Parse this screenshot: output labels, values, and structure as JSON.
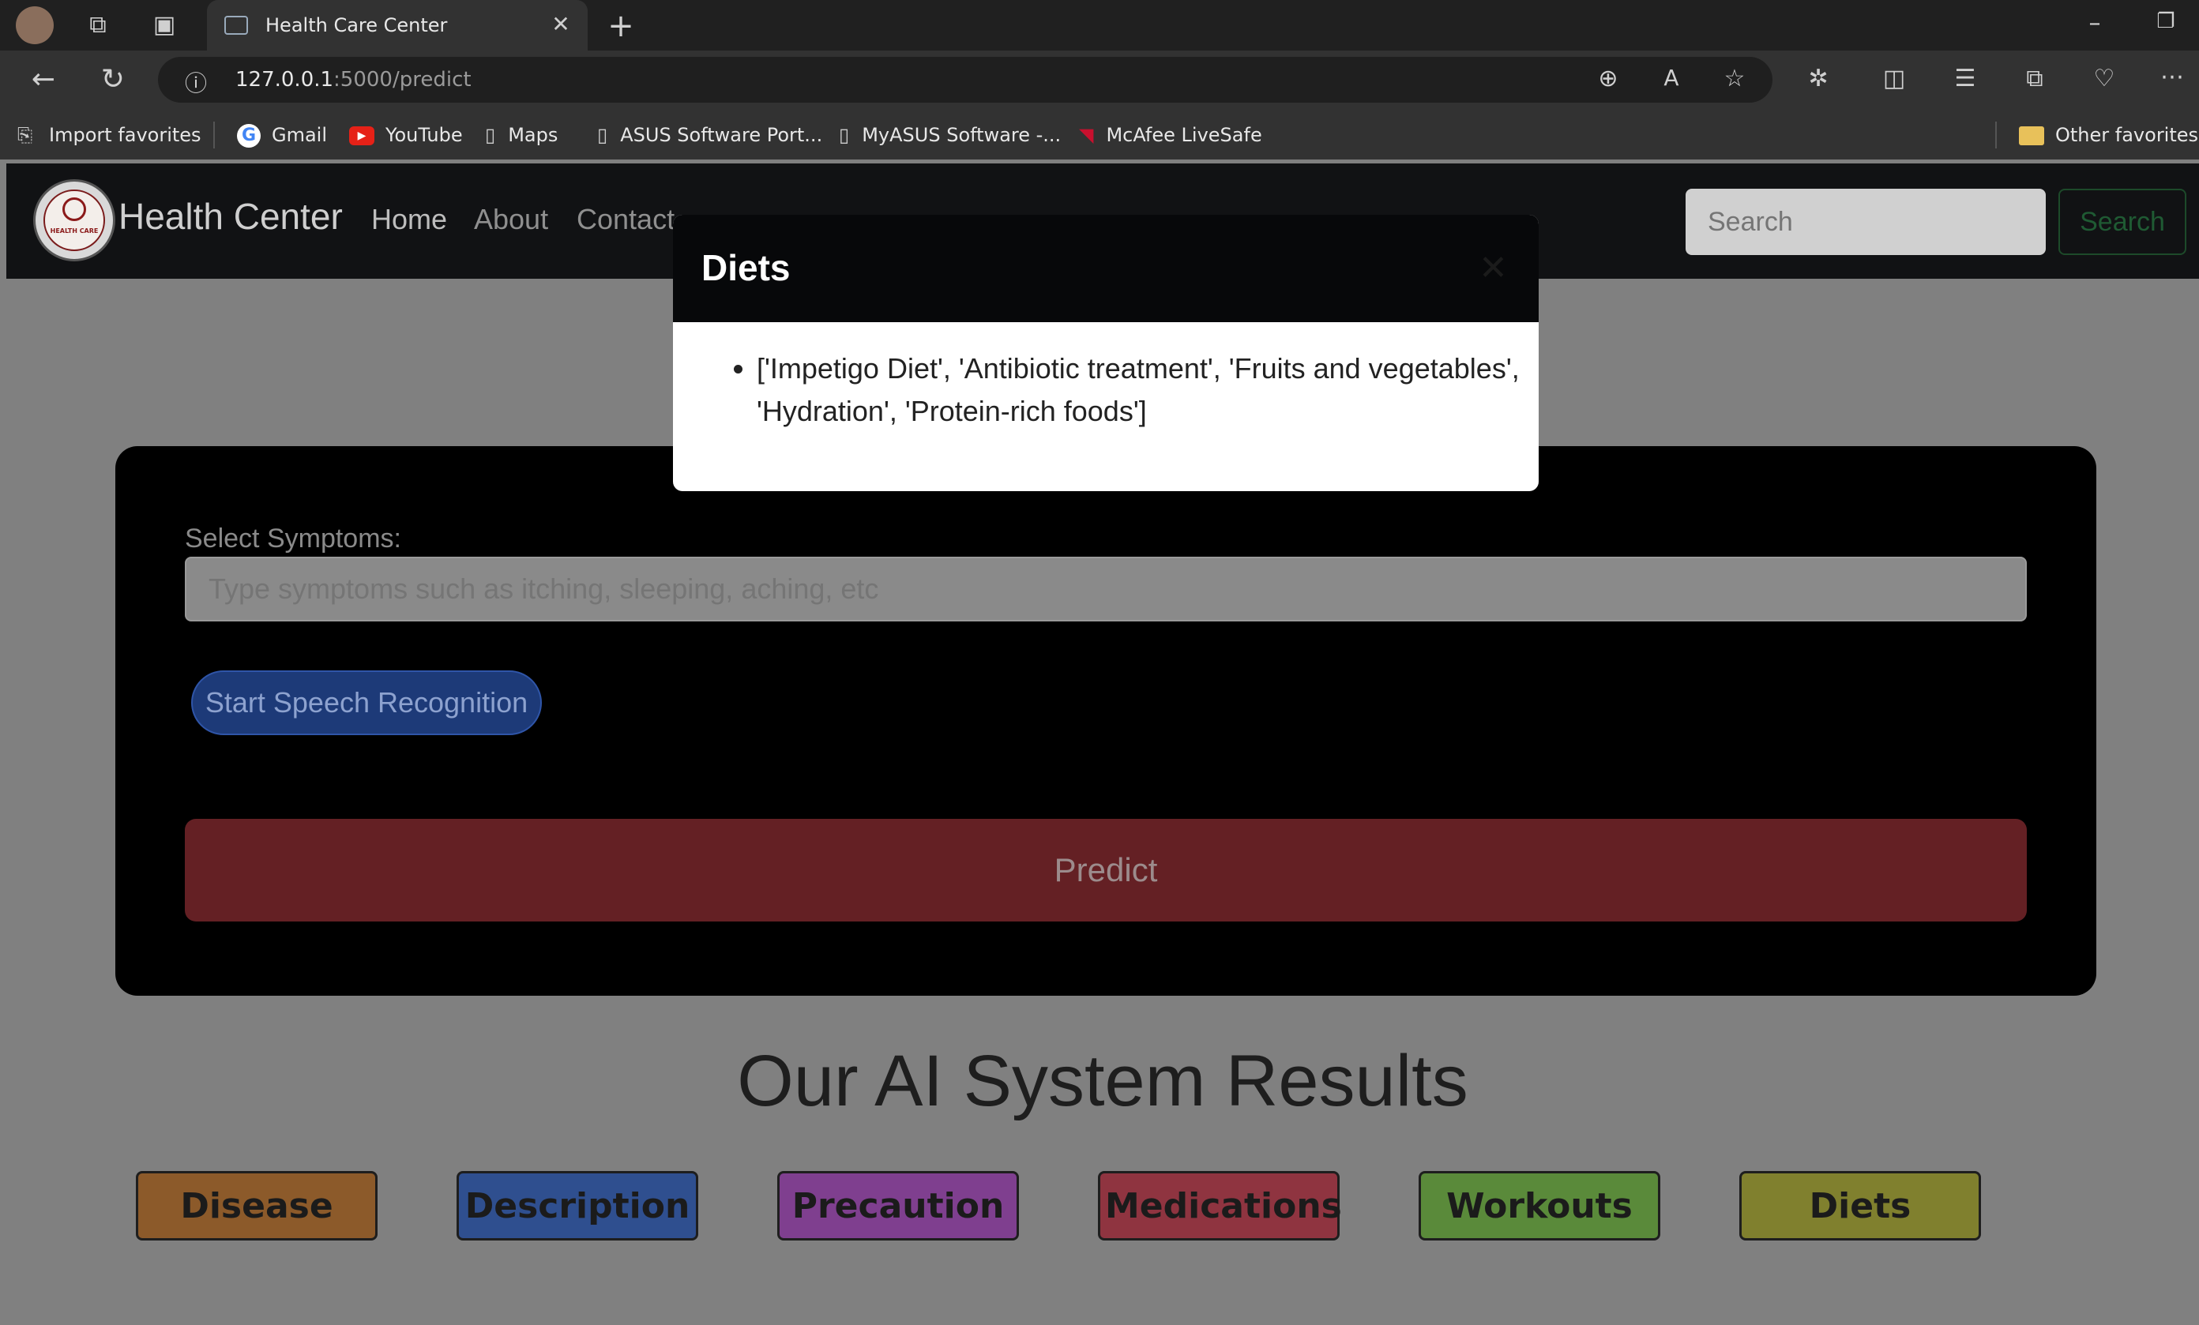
{
  "browser": {
    "tab_title": "Health Care Center",
    "url_host": "127.0.0.1",
    "url_path": ":5000/predict",
    "bookmarks": [
      "Import favorites",
      "Gmail",
      "YouTube",
      "Maps",
      "ASUS Software Port...",
      "MyASUS Software -...",
      "McAfee LiveSafe"
    ],
    "other_favorites": "Other favorites"
  },
  "navbar": {
    "brand": "Health Center",
    "logo_text": "HEALTH CARE",
    "links": [
      "Home",
      "About",
      "Contact"
    ],
    "search_placeholder": "Search",
    "search_button": "Search"
  },
  "form": {
    "symptoms_label": "Select Symptoms:",
    "symptoms_placeholder": "Type symptoms such as itching, sleeping, aching, etc",
    "speech_button": "Start Speech Recognition",
    "predict_button": "Predict"
  },
  "results": {
    "title": "Our AI System Results",
    "buttons": [
      {
        "label": "Disease",
        "color": "#8c5a2a"
      },
      {
        "label": "Description",
        "color": "#2f4f8f"
      },
      {
        "label": "Precaution",
        "color": "#7f3f8f"
      },
      {
        "label": "Medications",
        "color": "#8f3440"
      },
      {
        "label": "Workouts",
        "color": "#5a8a3a"
      },
      {
        "label": "Diets",
        "color": "#80802e"
      }
    ]
  },
  "modal": {
    "title": "Diets",
    "items": [
      "['Impetigo Diet', 'Antibiotic treatment', 'Fruits and vegetables', 'Hydration', 'Protein-rich foods']"
    ]
  }
}
